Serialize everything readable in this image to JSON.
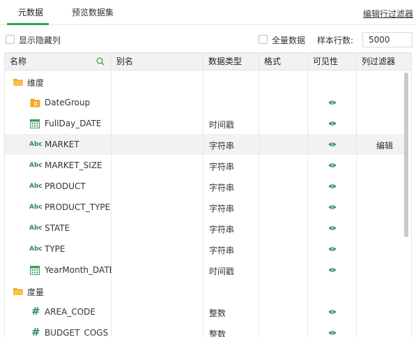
{
  "tabs": {
    "metadata": "元数据",
    "preview": "预览数据集",
    "edit_filter": "编辑行过滤器"
  },
  "options": {
    "show_hidden": "显示隐藏列",
    "all_data": "全量数据",
    "sample_rows_label": "样本行数:",
    "sample_rows_value": "5000"
  },
  "columns": {
    "name": "名称",
    "alias": "别名",
    "data_type": "数据类型",
    "format": "格式",
    "visibility": "可见性",
    "column_filter": "列过滤器"
  },
  "rows": [
    {
      "name": "维度",
      "type": "",
      "icon": "folder-icon",
      "level": 0,
      "visible": false,
      "filter": ""
    },
    {
      "name": "DateGroup",
      "type": "",
      "icon": "date-group-icon",
      "level": 1,
      "visible": true,
      "filter": ""
    },
    {
      "name": "FullDay_DATE",
      "type": "时间戳",
      "icon": "calendar-icon",
      "level": 1,
      "visible": true,
      "filter": ""
    },
    {
      "name": "MARKET",
      "type": "字符串",
      "icon": "text-type-icon",
      "level": 1,
      "visible": true,
      "filter": "编辑"
    },
    {
      "name": "MARKET_SIZE",
      "type": "字符串",
      "icon": "text-type-icon",
      "level": 1,
      "visible": true,
      "filter": ""
    },
    {
      "name": "PRODUCT",
      "type": "字符串",
      "icon": "text-type-icon",
      "level": 1,
      "visible": true,
      "filter": ""
    },
    {
      "name": "PRODUCT_TYPE",
      "type": "字符串",
      "icon": "text-type-icon",
      "level": 1,
      "visible": true,
      "filter": ""
    },
    {
      "name": "STATE",
      "type": "字符串",
      "icon": "text-type-icon",
      "level": 1,
      "visible": true,
      "filter": ""
    },
    {
      "name": "TYPE",
      "type": "字符串",
      "icon": "text-type-icon",
      "level": 1,
      "visible": true,
      "filter": ""
    },
    {
      "name": "YearMonth_DATE",
      "type": "时间戳",
      "icon": "calendar-icon",
      "level": 1,
      "visible": true,
      "filter": ""
    },
    {
      "name": "度量",
      "type": "",
      "icon": "folder-icon",
      "level": 0,
      "visible": false,
      "filter": ""
    },
    {
      "name": "AREA_CODE",
      "type": "整数",
      "icon": "number-type-icon",
      "level": 1,
      "visible": true,
      "filter": ""
    },
    {
      "name": "BUDGET_COGS",
      "type": "整数",
      "icon": "number-type-icon",
      "level": 1,
      "visible": true,
      "filter": ""
    }
  ],
  "icons": {
    "text_type": "Abc",
    "number_type": "#"
  },
  "colors": {
    "accent": "#2ea44f",
    "folder": "#f5a623",
    "row_highlight": "#f2f2f2"
  }
}
